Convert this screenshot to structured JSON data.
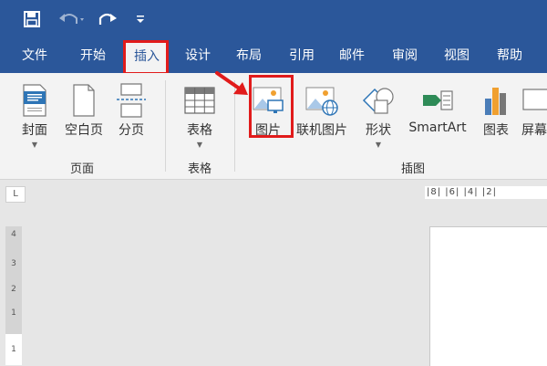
{
  "quick_access": {
    "save_icon": "save-icon",
    "undo_icon": "undo-icon",
    "redo_icon": "redo-icon",
    "customize_icon": "customize-quick-access-icon"
  },
  "tabs": [
    "文件",
    "开始",
    "插入",
    "设计",
    "布局",
    "引用",
    "邮件",
    "审阅",
    "视图",
    "帮助"
  ],
  "active_tab": "插入",
  "ribbon": {
    "pages_group": {
      "label": "页面",
      "buttons": [
        "封面",
        "空白页",
        "分页"
      ]
    },
    "table_group": {
      "label": "表格",
      "buttons": [
        "表格"
      ]
    },
    "illustrations_group": {
      "label": "插图",
      "buttons": [
        "图片",
        "联机图片",
        "形状",
        "SmartArt",
        "图表",
        "屏幕"
      ]
    }
  },
  "ruler": {
    "corner_mark": "L",
    "horizontal_ticks": "|8|  |6|  |4|  |2|",
    "vertical_ticks": [
      "4",
      "3",
      "2",
      "1",
      "1"
    ]
  },
  "colors": {
    "title_bar": "#2b579a",
    "ribbon_bg": "#f3f3f3",
    "highlight_box": "#e11b1b",
    "annotation_arrow": "#e11b1b"
  }
}
